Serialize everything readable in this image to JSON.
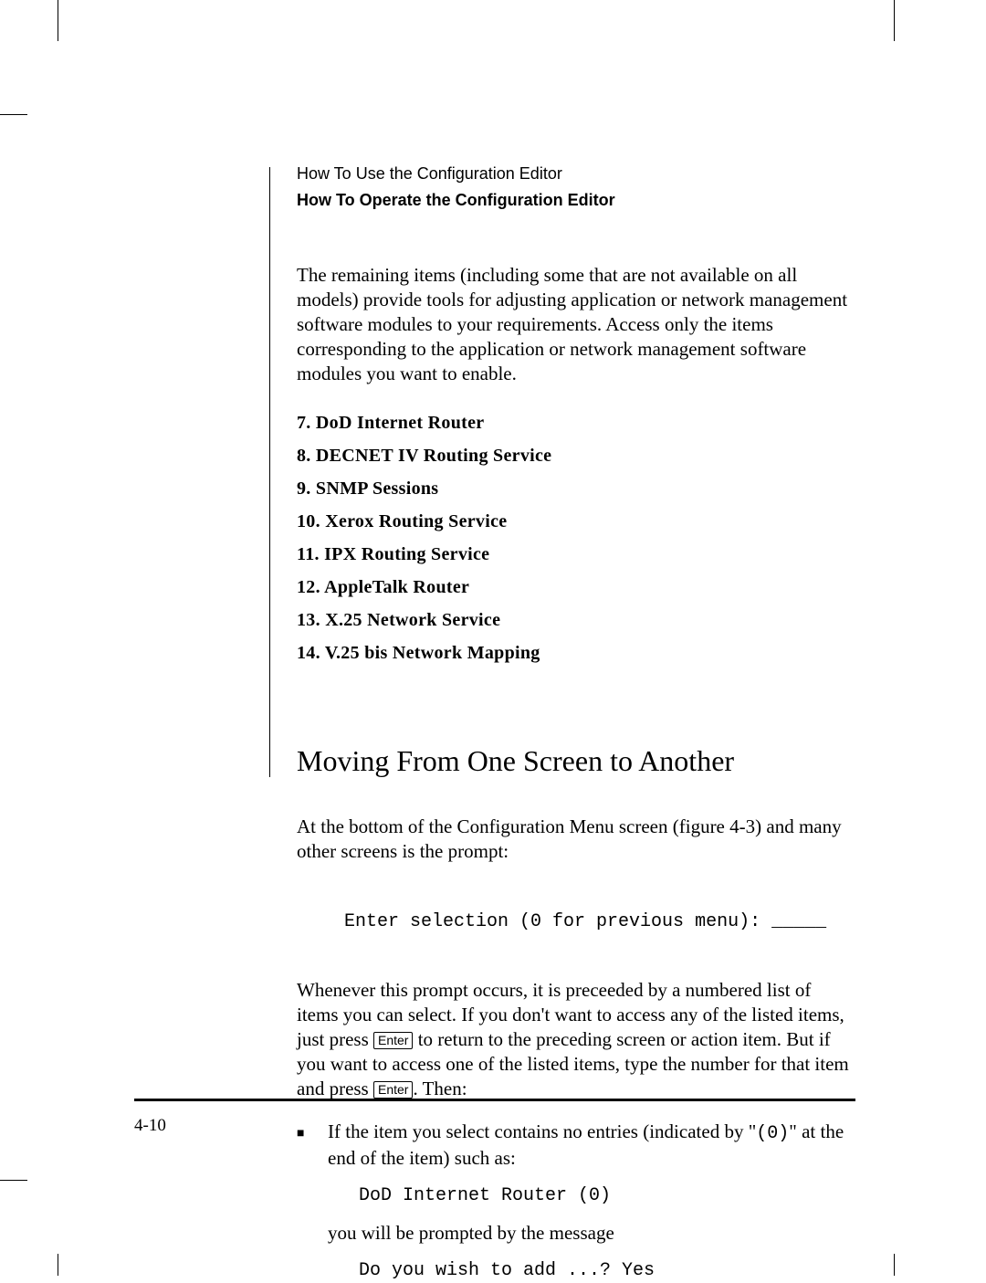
{
  "header": {
    "line1": "How To Use the Configuration Editor",
    "line2": "How To Operate the Configuration Editor"
  },
  "intro_para": "The remaining items (including some that are not available on all models) provide tools for adjusting application or network management software modules to your requirements. Access only the items corresponding to the application or network management software modules you want to enable.",
  "menu_items": [
    "7. DoD Internet Router",
    "8. DECNET IV Routing Service",
    "9. SNMP Sessions",
    "10. Xerox Routing Service",
    "11. IPX Routing Service",
    "12. AppleTalk Router",
    "13. X.25 Network Service",
    "14. V.25 bis Network Mapping"
  ],
  "section_heading": "Moving From One Screen to Another",
  "para_after_heading": "At the bottom of the Configuration Menu screen (figure 4-3)  and many other screens is the prompt:",
  "code_prompt": "Enter selection (0 for previous menu): _____",
  "nav": {
    "p3_a": "Whenever this prompt occurs, it is preceeded by a numbered list of items you can select. If you don't want to access any of the listed items, just press ",
    "p3_b": " to return to the preceding screen or action item. But if you want to access one of the listed items, type the number for that item and press ",
    "p3_c": ". Then:",
    "key_label": "Enter"
  },
  "bullet": {
    "lead_a": "If the item you select contains no entries (indicated by \"",
    "zero_token": "(0)",
    "lead_b": "\" at the end of the item) such as:",
    "code1": "DoD Internet Router (0)",
    "mid": "you will be prompted by the message",
    "code2": "Do you wish to add ...?  Yes"
  },
  "page_number": "4-10"
}
